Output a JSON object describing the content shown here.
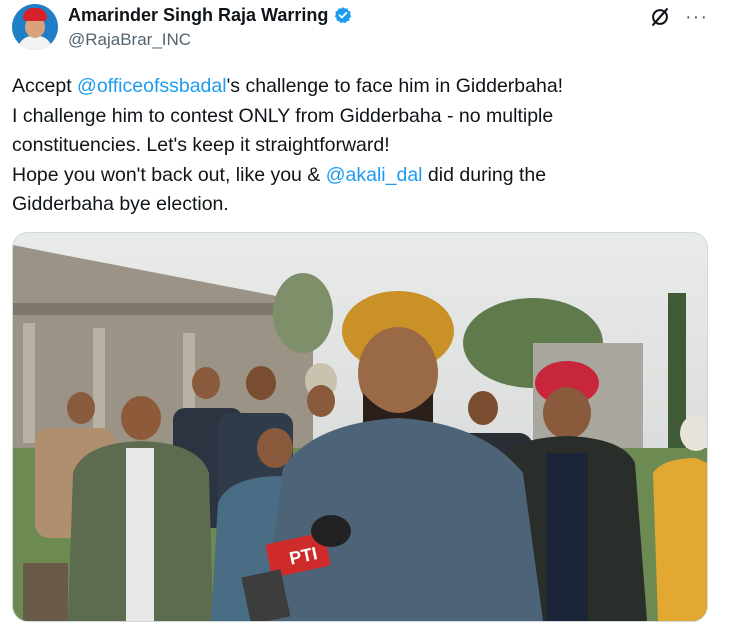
{
  "author": {
    "name": "Amarinder Singh Raja Warring",
    "handle": "@RajaBrar_INC",
    "verified": true
  },
  "icons": {
    "verified": "verified-badge-icon",
    "grok": "grok-icon",
    "more": "more-options-icon"
  },
  "more_label": "···",
  "tweet": {
    "lines": [
      {
        "before": "Accept ",
        "mention": "@officeofssbadal",
        "after": "'s challenge to face him in Gidderbaha!"
      },
      {
        "before": "I challenge him to contest ONLY from Gidderbaha - no multiple",
        "mention": "",
        "after": ""
      },
      {
        "before": "constituencies. Let's keep it straightforward!",
        "mention": "",
        "after": ""
      },
      {
        "before": "Hope you won't back out, like you & ",
        "mention": "@akali_dal",
        "after": " did during the"
      },
      {
        "before": "Gidderbaha bye election.",
        "mention": "",
        "after": ""
      }
    ]
  },
  "media": {
    "mic_label": "PTI"
  },
  "colors": {
    "accent": "#1d9bf0",
    "text": "#0f1419",
    "secondary": "#536471"
  }
}
